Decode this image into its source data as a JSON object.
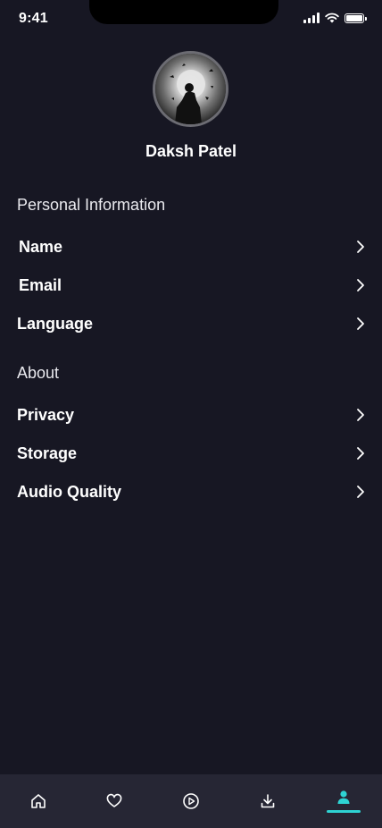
{
  "status_bar": {
    "time": "9:41"
  },
  "profile": {
    "name": "Daksh Patel"
  },
  "sections": [
    {
      "title": "Personal Information",
      "items": [
        "Name",
        "Email",
        "Language"
      ]
    },
    {
      "title": "About",
      "items": [
        "Privacy",
        "Storage",
        "Audio Quality"
      ]
    }
  ],
  "bottom_nav": {
    "items": [
      "home-icon",
      "heart-icon",
      "play-icon",
      "download-icon",
      "profile-icon"
    ],
    "active": "profile-icon"
  },
  "colors": {
    "background": "#171723",
    "nav_background": "#262634",
    "accent": "#2ed3d3"
  }
}
